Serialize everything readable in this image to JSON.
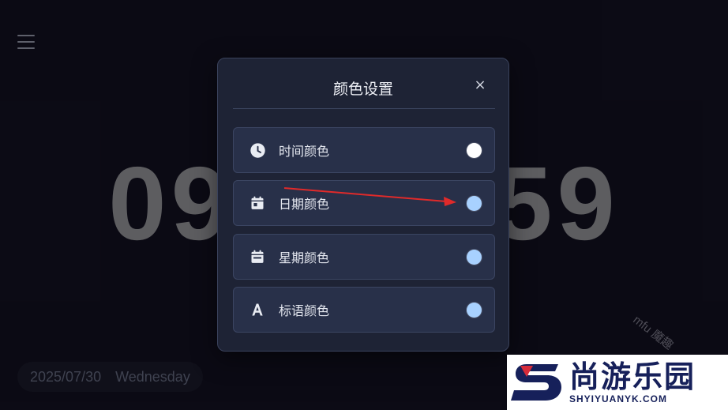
{
  "background": {
    "color": "#0d0c16"
  },
  "clock": {
    "left": "09",
    "right": "59"
  },
  "date_pill": {
    "date": "2025/07/30",
    "weekday": "Wednesday"
  },
  "modal": {
    "title": "颜色设置",
    "close_label": "×",
    "items": [
      {
        "label": "时间颜色",
        "icon": "clock-icon",
        "color": "#ffffff"
      },
      {
        "label": "日期颜色",
        "icon": "calendar-icon",
        "color": "#a8d1ff"
      },
      {
        "label": "星期颜色",
        "icon": "calendar-week-icon",
        "color": "#a8d1ff"
      },
      {
        "label": "标语颜色",
        "icon": "font-a-icon",
        "color": "#a8d1ff"
      }
    ]
  },
  "watermark": {
    "text": "mfu 魔趣"
  },
  "brand": {
    "name": "尚游乐园",
    "url": "SHYIYUANYK.COM"
  },
  "colors": {
    "accent_arrow": "#e02a2a",
    "brand_red": "#d62b3a",
    "brand_navy": "#16205a"
  }
}
